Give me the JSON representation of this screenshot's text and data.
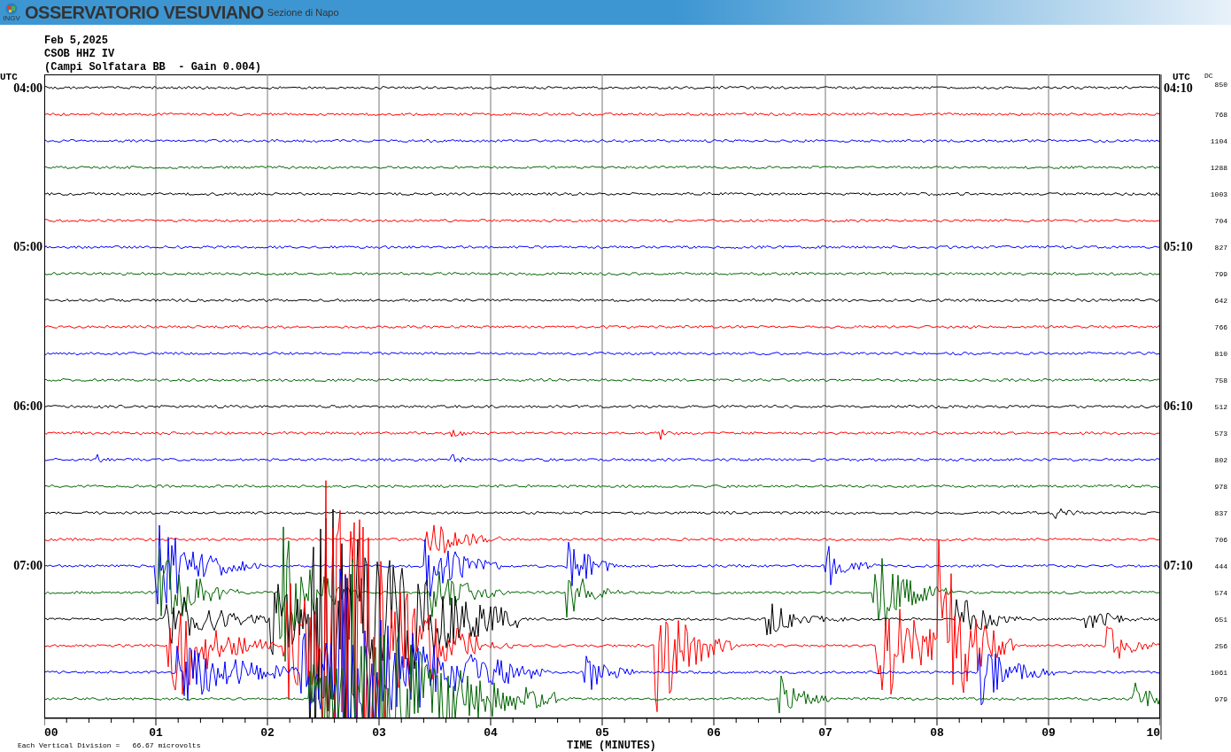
{
  "header": {
    "logo_text": "INGV",
    "title": "OSSERVATORIO VESUVIANO",
    "subtitle": "Sezione di Napo"
  },
  "info": [
    "Feb 5,2025",
    "CSOB HHZ IV",
    "(Campi Solfatara BB  - Gain 0.004)"
  ],
  "left_axis_title": "UTC",
  "right_axis_title": "UTC",
  "dc_title": "DC",
  "rows": [
    {
      "color": "#000000",
      "left": "04:00",
      "right": "04:10",
      "dc": "850"
    },
    {
      "color": "#ff0000",
      "dc": "768"
    },
    {
      "color": "#0000ff",
      "dc": "1104"
    },
    {
      "color": "#006400",
      "dc": "1288"
    },
    {
      "color": "#000000",
      "dc": "1003"
    },
    {
      "color": "#ff0000",
      "dc": "704"
    },
    {
      "color": "#0000ff",
      "left": "05:00",
      "right": "05:10",
      "dc": "827"
    },
    {
      "color": "#006400",
      "dc": "799"
    },
    {
      "color": "#000000",
      "dc": "642"
    },
    {
      "color": "#ff0000",
      "dc": "766"
    },
    {
      "color": "#0000ff",
      "dc": "810"
    },
    {
      "color": "#006400",
      "dc": "758"
    },
    {
      "color": "#000000",
      "left": "06:00",
      "right": "06:10",
      "dc": "512"
    },
    {
      "color": "#ff0000",
      "dc": "573"
    },
    {
      "color": "#0000ff",
      "dc": "802"
    },
    {
      "color": "#006400",
      "dc": "978"
    },
    {
      "color": "#000000",
      "dc": "837"
    },
    {
      "color": "#ff0000",
      "dc": "706"
    },
    {
      "color": "#0000ff",
      "left": "07:00",
      "right": "07:10",
      "dc": "444"
    },
    {
      "color": "#006400",
      "dc": "574"
    },
    {
      "color": "#000000",
      "dc": "651"
    },
    {
      "color": "#ff0000",
      "dc": "256"
    },
    {
      "color": "#0000ff",
      "dc": "1061"
    },
    {
      "color": "#006400",
      "dc": "979"
    }
  ],
  "x_ticks": [
    "00",
    "01",
    "02",
    "03",
    "04",
    "05",
    "06",
    "07",
    "08",
    "09",
    "10"
  ],
  "x_label": "TIME (MINUTES)",
  "footer": "Each Vertical Division =   66.67 microvolts"
}
